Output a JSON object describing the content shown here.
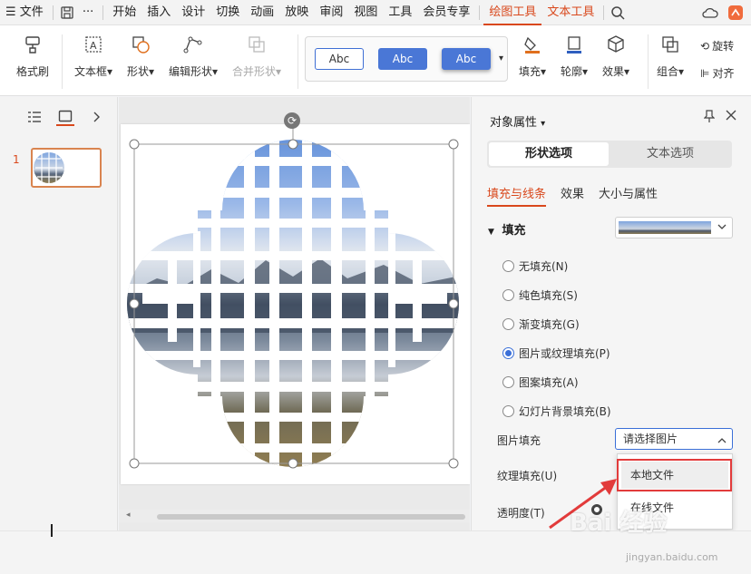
{
  "menubar": {
    "file": "文件",
    "more": "···",
    "items": [
      "开始",
      "插入",
      "设计",
      "切换",
      "动画",
      "放映",
      "审阅",
      "视图",
      "工具",
      "会员专享"
    ],
    "active_tab": "绘图工具",
    "text_tab": "文本工具"
  },
  "ribbon": {
    "format_painter": "格式刷",
    "textbox": "文本框",
    "shape": "形状",
    "edit_shape": "编辑形状",
    "merge_shape": "合并形状",
    "style_samples": [
      "Abc",
      "Abc",
      "Abc"
    ],
    "fill": "填充",
    "outline": "轮廓",
    "effect": "效果",
    "group": "组合",
    "rotate": "旋转",
    "align": "对齐"
  },
  "slides": {
    "current_number": "1"
  },
  "panel": {
    "title": "对象属性",
    "tabs": [
      "形状选项",
      "文本选项"
    ],
    "subtabs": [
      "填充与线条",
      "效果",
      "大小与属性"
    ],
    "section": "填充",
    "fill_options": [
      {
        "label": "无填充(N)",
        "selected": false
      },
      {
        "label": "纯色填充(S)",
        "selected": false
      },
      {
        "label": "渐变填充(G)",
        "selected": false
      },
      {
        "label": "图片或纹理填充(P)",
        "selected": true
      },
      {
        "label": "图案填充(A)",
        "selected": false
      },
      {
        "label": "幻灯片背景填充(B)",
        "selected": false
      }
    ],
    "picture_fill_label": "图片填充",
    "picture_select_value": "请选择图片",
    "picture_source_options": [
      "本地文件",
      "在线文件"
    ],
    "texture_fill_label": "纹理填充(U)",
    "transparency_label": "透明度(T)"
  },
  "watermark": {
    "logo": "Bai 经验",
    "url": "jingyan.baidu.com"
  },
  "colors": {
    "accent": "#d9481c",
    "selection_blue": "#3a6fd8",
    "callout_red": "#e23b3b"
  }
}
